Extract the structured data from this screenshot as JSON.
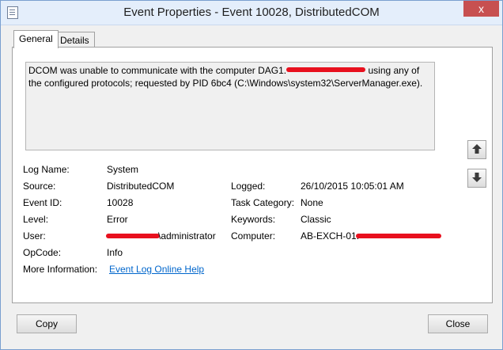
{
  "window": {
    "title": "Event Properties - Event 10028, DistributedCOM",
    "close_glyph": "x"
  },
  "tabs": [
    {
      "label": "General",
      "active": true
    },
    {
      "label": "Details",
      "active": false
    }
  ],
  "description": {
    "line1_before": "DCOM was unable to communicate with the computer DAG1.",
    "line1_after": " using any of",
    "line2": "the configured protocols; requested by PID      6bc4 (C:\\Windows\\system32\\ServerManager.exe)."
  },
  "fields": {
    "log_name_label": "Log Name:",
    "log_name_value": "System",
    "source_label": "Source:",
    "source_value": "DistributedCOM",
    "logged_label": "Logged:",
    "logged_value": "26/10/2015 10:05:01 AM",
    "event_id_label": "Event ID:",
    "event_id_value": "10028",
    "task_category_label": "Task Category:",
    "task_category_value": "None",
    "level_label": "Level:",
    "level_value": "Error",
    "keywords_label": "Keywords:",
    "keywords_value": "Classic",
    "user_label": "User:",
    "user_value": "\\administrator",
    "computer_label": "Computer:",
    "computer_value": "AB-EXCH-01.",
    "opcode_label": "OpCode:",
    "opcode_value": "Info",
    "more_info_label": "More Information:",
    "more_info_link": "Event Log Online Help"
  },
  "buttons": {
    "copy": "Copy",
    "close": "Close"
  },
  "icons": {
    "up": "arrow-up-icon",
    "down": "arrow-down-icon"
  },
  "colors": {
    "redaction": "#e8101e",
    "link": "#0066cc",
    "title_bar": "#e4eefb"
  }
}
